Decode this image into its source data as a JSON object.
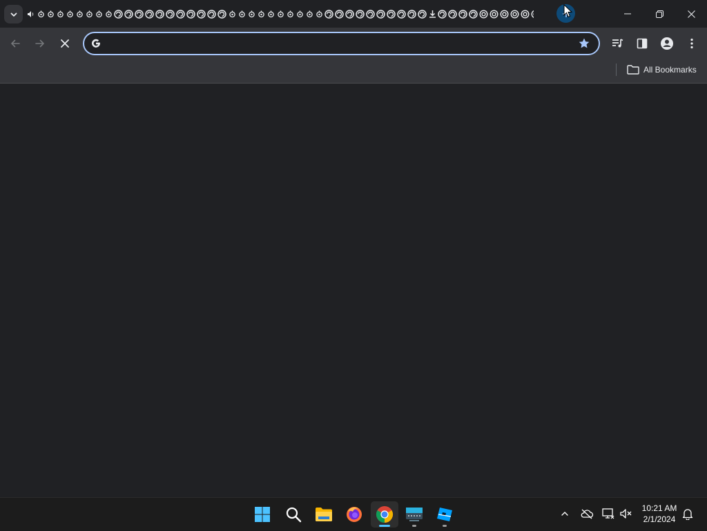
{
  "window": {
    "tab_count_favicons": 52,
    "controls": [
      "minimize",
      "restore",
      "close"
    ]
  },
  "toolbar": {
    "back_enabled": false,
    "forward_enabled": false,
    "loading": true,
    "omnibox": {
      "value": "",
      "placeholder": ""
    },
    "icons": [
      "media-control-icon",
      "side-panel-icon",
      "profile-icon",
      "menu-icon"
    ]
  },
  "bookmarks_bar": {
    "all_bookmarks_label": "All Bookmarks"
  },
  "taskbar": {
    "apps": [
      "start",
      "search",
      "file-explorer",
      "firefox",
      "chrome",
      "keyboard-app",
      "roblox-studio"
    ],
    "active_app": "chrome",
    "clock": {
      "time": "10:21 AM",
      "date": "2/1/2024"
    }
  },
  "colors": {
    "background": "#202124",
    "toolbar": "#35363a",
    "omnibox_focus": "#a8c7fa",
    "accent_blue": "#0e4a78",
    "taskbar": "#1c1c1c"
  }
}
